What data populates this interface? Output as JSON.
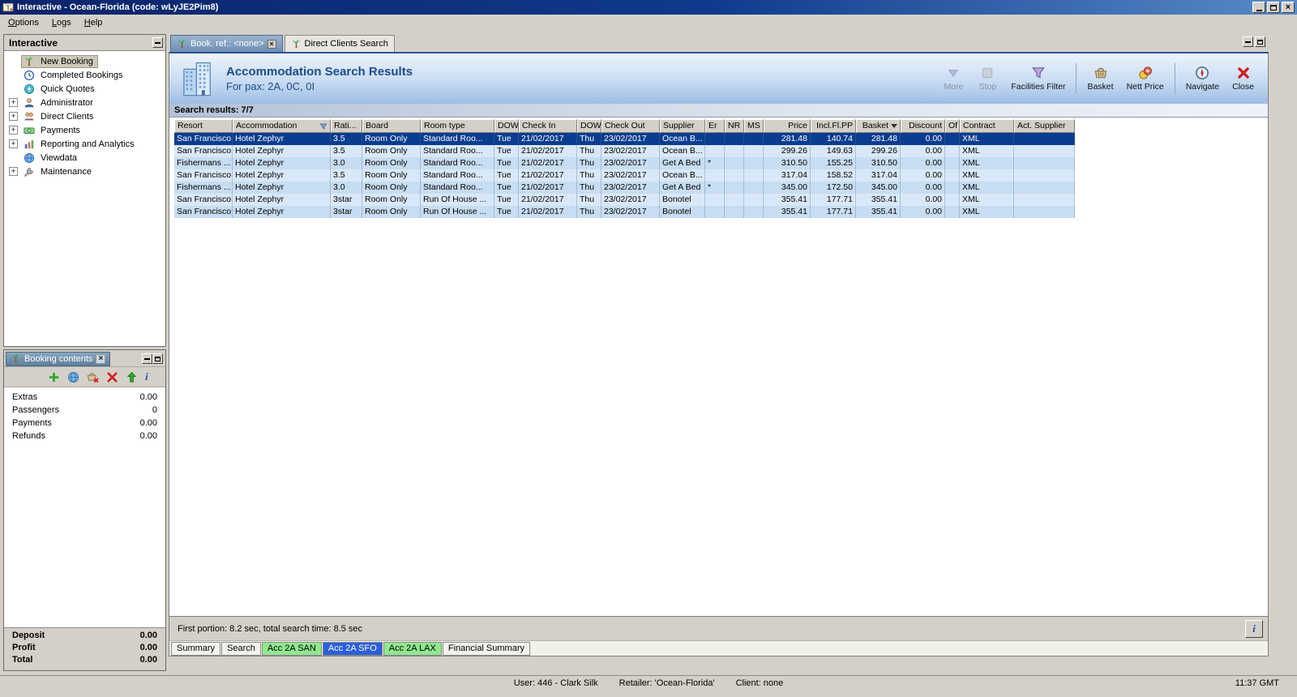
{
  "window": {
    "title": "Interactive - Ocean-Florida (code: wLyJE2Pim8)",
    "time": "11:37 GMT",
    "status_user": "User: 446 - Clark Silk",
    "status_retailer": "Retailer: 'Ocean-Florida'",
    "status_client": "Client: none"
  },
  "menu": {
    "items": [
      {
        "label": "Options"
      },
      {
        "label": "Logs"
      },
      {
        "label": "Help"
      }
    ]
  },
  "sidebar": {
    "title": "Interactive",
    "items": [
      {
        "label": "New Booking",
        "icon": "palm",
        "expandable": false,
        "selected": true
      },
      {
        "label": "Completed Bookings",
        "icon": "clock",
        "expandable": false
      },
      {
        "label": "Quick Quotes",
        "icon": "bolt",
        "expandable": false
      },
      {
        "label": "Administrator",
        "icon": "person",
        "expandable": true
      },
      {
        "label": "Direct Clients",
        "icon": "people",
        "expandable": true
      },
      {
        "label": "Payments",
        "icon": "payments",
        "expandable": true
      },
      {
        "label": "Reporting and Analytics",
        "icon": "report",
        "expandable": true
      },
      {
        "label": "Viewdata",
        "icon": "globe",
        "expandable": false
      },
      {
        "label": "Maintenance",
        "icon": "wrench",
        "expandable": true
      }
    ]
  },
  "booking_contents": {
    "title": "Booking contents",
    "toolbar": [
      {
        "icon": "add"
      },
      {
        "icon": "globe"
      },
      {
        "icon": "basket-remove"
      },
      {
        "icon": "delete"
      },
      {
        "icon": "up-arrow"
      },
      {
        "icon": "info"
      }
    ],
    "rows": [
      {
        "label": "Extras",
        "value": "0.00"
      },
      {
        "label": "Passengers",
        "value": "0"
      },
      {
        "label": "Payments",
        "value": "0.00"
      },
      {
        "label": "Refunds",
        "value": "0.00"
      }
    ],
    "totals": [
      {
        "label": "Deposit",
        "value": "0.00"
      },
      {
        "label": "Profit",
        "value": "0.00"
      },
      {
        "label": "Total",
        "value": "0.00"
      }
    ]
  },
  "tabs": [
    {
      "label": "Book. ref.: <none>",
      "active": true,
      "closable": true
    },
    {
      "label": "Direct Clients Search",
      "active": false,
      "closable": false
    }
  ],
  "header": {
    "title": "Accommodation Search Results",
    "subtitle": "For pax: 2A, 0C, 0I",
    "tools": [
      {
        "label": "More",
        "icon": "more",
        "disabled": true
      },
      {
        "label": "Stop",
        "icon": "stop",
        "disabled": true
      },
      {
        "label": "Facilities Filter",
        "icon": "funnel",
        "sep_after": true
      },
      {
        "label": "Basket",
        "icon": "basket"
      },
      {
        "label": "Nett Price",
        "icon": "nett",
        "sep_after": true
      },
      {
        "label": "Navigate",
        "icon": "navigate"
      },
      {
        "label": "Close",
        "icon": "closex"
      }
    ]
  },
  "results": {
    "summary": "Search results: 7/7",
    "footer": "First portion: 8.2 sec, total search time: 8.5 sec",
    "filtered_column": "Accommodation",
    "sorted_column": "Basket",
    "selected_row": 0,
    "columns": [
      "Resort",
      "Accommodation",
      "Rati...",
      "Board",
      "Room type",
      "DOW",
      "Check In",
      "DOW",
      "Check Out",
      "Supplier",
      "Er",
      "NR",
      "MS",
      "Price",
      "Incl.Fl.PP",
      "Basket",
      "Discount",
      "Of",
      "Contract",
      "Act. Supplier"
    ],
    "rows": [
      [
        "San Francisco",
        "Hotel Zephyr",
        "3.5",
        "Room Only",
        "Standard Roo...",
        "Tue",
        "21/02/2017",
        "Thu",
        "23/02/2017",
        "Ocean B...",
        "",
        "",
        "",
        "281.48",
        "140.74",
        "281.48",
        "0.00",
        "",
        "XML",
        ""
      ],
      [
        "San Francisco",
        "Hotel Zephyr",
        "3.5",
        "Room Only",
        "Standard Roo...",
        "Tue",
        "21/02/2017",
        "Thu",
        "23/02/2017",
        "Ocean B...",
        "",
        "",
        "",
        "299.26",
        "149.63",
        "299.26",
        "0.00",
        "",
        "XML",
        ""
      ],
      [
        "Fishermans ...",
        "Hotel Zephyr",
        "3.0",
        "Room Only",
        "Standard Roo...",
        "Tue",
        "21/02/2017",
        "Thu",
        "23/02/2017",
        "Get A Bed",
        "*",
        "",
        "",
        "310.50",
        "155.25",
        "310.50",
        "0.00",
        "",
        "XML",
        ""
      ],
      [
        "San Francisco",
        "Hotel Zephyr",
        "3.5",
        "Room Only",
        "Standard Roo...",
        "Tue",
        "21/02/2017",
        "Thu",
        "23/02/2017",
        "Ocean B...",
        "",
        "",
        "",
        "317.04",
        "158.52",
        "317.04",
        "0.00",
        "",
        "XML",
        ""
      ],
      [
        "Fishermans ...",
        "Hotel Zephyr",
        "3.0",
        "Room Only",
        "Standard Roo...",
        "Tue",
        "21/02/2017",
        "Thu",
        "23/02/2017",
        "Get A Bed",
        "*",
        "",
        "",
        "345.00",
        "172.50",
        "345.00",
        "0.00",
        "",
        "XML",
        ""
      ],
      [
        "San Francisco",
        "Hotel Zephyr",
        "3star",
        "Room Only",
        "Run Of House ...",
        "Tue",
        "21/02/2017",
        "Thu",
        "23/02/2017",
        "Bonotel",
        "",
        "",
        "",
        "355.41",
        "177.71",
        "355.41",
        "0.00",
        "",
        "XML",
        ""
      ],
      [
        "San Francisco",
        "Hotel Zephyr",
        "3star",
        "Room Only",
        "Run Of House ...",
        "Tue",
        "21/02/2017",
        "Thu",
        "23/02/2017",
        "Bonotel",
        "",
        "",
        "",
        "355.41",
        "177.71",
        "355.41",
        "0.00",
        "",
        "XML",
        ""
      ]
    ]
  },
  "bottom_tabs": [
    {
      "label": "Summary",
      "style": "plain"
    },
    {
      "label": "Search",
      "style": "plain"
    },
    {
      "label": "Acc 2A SAN",
      "style": "green"
    },
    {
      "label": "Acc 2A SFO",
      "style": "blue",
      "active": true
    },
    {
      "label": "Acc 2A LAX",
      "style": "green"
    },
    {
      "label": "Financial Summary",
      "style": "plain"
    }
  ]
}
